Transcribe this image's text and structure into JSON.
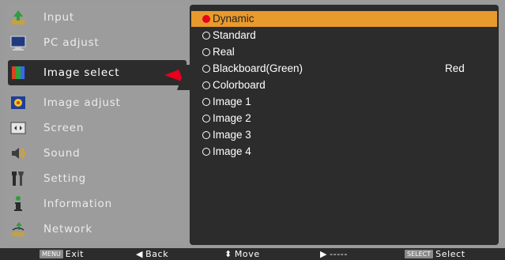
{
  "menu": {
    "items": [
      {
        "label": "Input",
        "icon": "input-icon"
      },
      {
        "label": "PC adjust",
        "icon": "pc-adjust-icon"
      },
      {
        "label": "Image select",
        "icon": "image-select-icon"
      },
      {
        "label": "Image adjust",
        "icon": "image-adjust-icon"
      },
      {
        "label": "Screen",
        "icon": "screen-icon"
      },
      {
        "label": "Sound",
        "icon": "sound-icon"
      },
      {
        "label": "Setting",
        "icon": "setting-icon"
      },
      {
        "label": "Information",
        "icon": "information-icon"
      },
      {
        "label": "Network",
        "icon": "network-icon"
      }
    ],
    "selected": "Image select"
  },
  "options": {
    "items": [
      {
        "label": "Dynamic"
      },
      {
        "label": "Standard"
      },
      {
        "label": "Real"
      },
      {
        "label": "Blackboard(Green)",
        "value": "Red"
      },
      {
        "label": "Colorboard"
      },
      {
        "label": "Image 1"
      },
      {
        "label": "Image 2"
      },
      {
        "label": "Image 3"
      },
      {
        "label": "Image 4"
      }
    ],
    "selected": "Dynamic"
  },
  "bottom_bar": {
    "exit": {
      "key": "MENU",
      "label": "Exit"
    },
    "back": {
      "symbol": "◀",
      "label": "Back"
    },
    "move": {
      "symbol": "⬍",
      "label": "Move"
    },
    "next": {
      "symbol": "▶",
      "label": "-----"
    },
    "select": {
      "key": "SELECT",
      "label": "Select"
    }
  },
  "colors": {
    "accent_red": "#e8001c",
    "highlight_orange": "#e99a2c",
    "panel_dark": "#2c2c2c",
    "menu_gray": "#9c9c9c"
  }
}
